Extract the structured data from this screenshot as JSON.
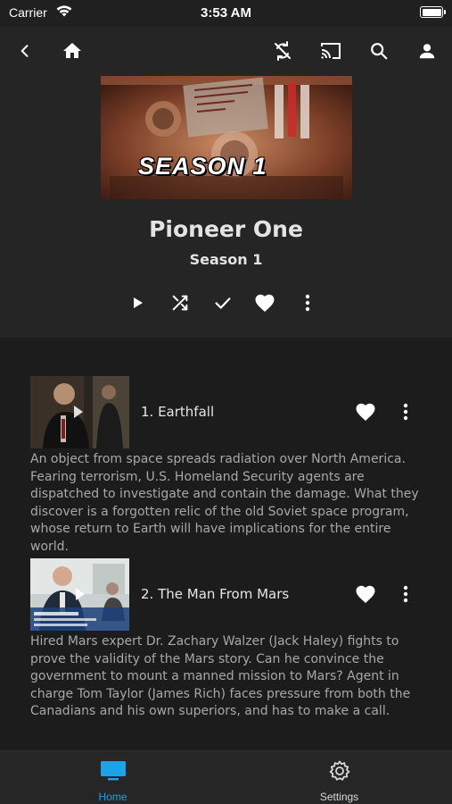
{
  "status_bar": {
    "carrier": "Carrier",
    "time": "3:53 AM"
  },
  "toolbar": {
    "icons": [
      "back-chevron-icon",
      "home-icon",
      "sync-disabled-icon",
      "cast-icon",
      "search-icon",
      "account-icon"
    ]
  },
  "header": {
    "art_text": "SEASON 1",
    "show_title": "Pioneer One",
    "season_label": "Season 1"
  },
  "actions": {
    "icons": [
      "play-icon",
      "shuffle-icon",
      "check-icon",
      "heart-icon",
      "more-vertical-icon"
    ]
  },
  "episodes": [
    {
      "title": "1. Earthfall",
      "description": "An object from space spreads radiation over North America. Fearing terrorism, U.S. Homeland Security agents are dispatched to investigate and contain the damage. What they discover is a forgotten relic of the old Soviet space program, whose return to Earth will have implications for the entire world."
    },
    {
      "title": "2. The Man From Mars",
      "description": "Hired Mars expert Dr. Zachary Walzer (Jack Haley) fights to prove the validity of the Mars story. Can he convince the government to mount a manned mission to Mars? Agent in charge Tom Taylor (James Rich) faces pressure from both the Canadians and his own superiors, and has to make a call."
    }
  ],
  "tab_bar": {
    "tabs": [
      {
        "label": "Home",
        "icon": "tv-icon",
        "active": true
      },
      {
        "label": "Settings",
        "icon": "gear-icon",
        "active": false
      }
    ]
  },
  "colors": {
    "accent": "#1aa3e8",
    "background": "#1c1c1c",
    "header_background": "#252525",
    "tab_inactive": "#d9d9d9"
  }
}
